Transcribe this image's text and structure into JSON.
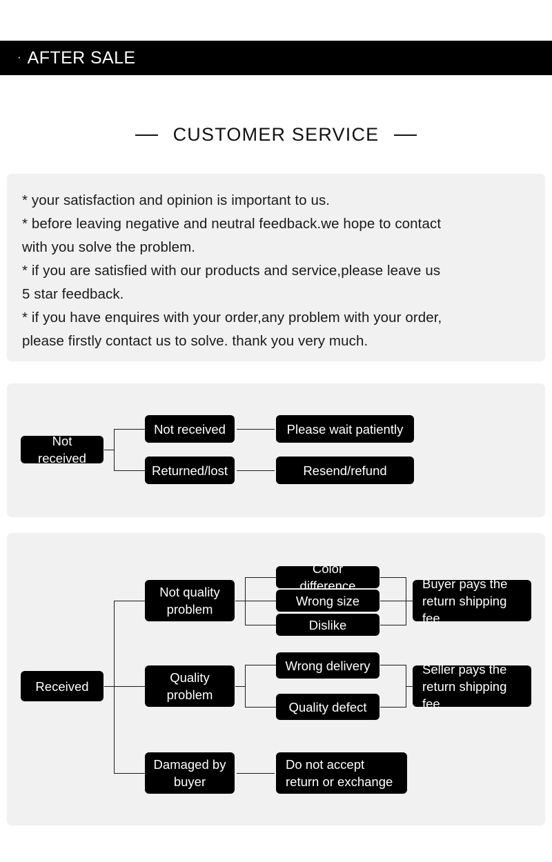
{
  "header": {
    "bullet": "·",
    "title": "AFTER SALE"
  },
  "section": {
    "title": "CUSTOMER SERVICE",
    "left_rule": "—",
    "right_rule": "—"
  },
  "policy": {
    "lines": [
      "* your satisfaction and opinion is important to us.",
      "* before leaving negative and neutral feedback.we hope to contact",
      "with you solve the problem.",
      "* if you are satisfied with our products and service,please leave us",
      "5 star feedback.",
      "* if you have enquires with your order,any problem with your order,",
      "please firstly contact us to solve. thank you very much."
    ]
  },
  "flow_not_received": {
    "root": "Not received",
    "branches": [
      {
        "cause": "Not received",
        "outcome": "Please wait patiently"
      },
      {
        "cause": "Returned/lost",
        "outcome": "Resend/refund"
      }
    ]
  },
  "flow_received": {
    "root": "Received",
    "groups": [
      {
        "category": "Not quality problem",
        "reasons": [
          "Color difference",
          "Wrong size",
          "Dislike"
        ],
        "outcome": "Buyer pays the return shipping fee"
      },
      {
        "category": "Quality problem",
        "reasons": [
          "Wrong delivery",
          "Quality defect"
        ],
        "outcome": "Seller pays the return shipping fee"
      },
      {
        "category": "Damaged by buyer",
        "reasons": [],
        "outcome": "Do not accept return or exchange"
      }
    ]
  },
  "colors": {
    "header_bg": "#000000",
    "panel_bg": "#f1f1f1",
    "box_bg": "#000000",
    "box_text": "#ffffff",
    "page_bg": "#ffffff",
    "line": "#1a1a1a"
  }
}
